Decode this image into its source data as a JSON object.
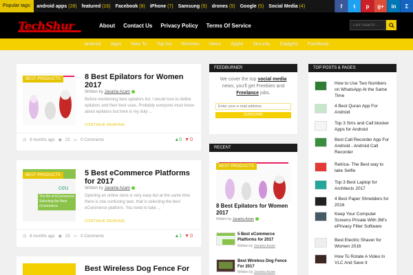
{
  "topbar": {
    "label": "Popular tags:",
    "tags": [
      {
        "name": "android apps",
        "count": "(28)"
      },
      {
        "name": "featured",
        "count": "(16)"
      },
      {
        "name": "Facebook",
        "count": "(8)"
      },
      {
        "name": "iPhone",
        "count": "(7)"
      },
      {
        "name": "Samsung",
        "count": "(5)"
      },
      {
        "name": "drones",
        "count": "(5)"
      },
      {
        "name": "Google",
        "count": "(5)"
      },
      {
        "name": "Social Media",
        "count": "(4)"
      }
    ],
    "social": [
      {
        "glyph": "f",
        "color": "#3b5998",
        "icon": "facebook-icon"
      },
      {
        "glyph": "t",
        "color": "#1da1f2",
        "icon": "twitter-icon"
      },
      {
        "glyph": "p",
        "color": "#cb2027",
        "icon": "pinterest-icon"
      },
      {
        "glyph": "g+",
        "color": "#dd4b39",
        "icon": "google-plus-icon"
      },
      {
        "glyph": "in",
        "color": "#0077b5",
        "icon": "linkedin-icon"
      },
      {
        "glyph": "Σ",
        "color": "#1565c0",
        "icon": "rss-icon"
      }
    ]
  },
  "header": {
    "logo_text": "TechShur",
    "nav": [
      "About",
      "Contact Us",
      "Privacy Policy",
      "Terms Of Service"
    ],
    "search_placeholder": "Live Search ..."
  },
  "subnav": [
    "Android",
    "Apps",
    "How To",
    "Top list",
    "Reviews",
    "News",
    "Apple",
    "Security",
    "Gadgets",
    "Facebook"
  ],
  "posts": [
    {
      "badge": "BEST PRODUCTS",
      "title": "8 Best Epilators for Women 2017",
      "author_prefix": "Written by",
      "author": "Javairia Azam",
      "excerpt": "Before mentioning best epilators list, I would love to define epilators and their best uses. Probably everyone must know about epilators but here is my duty ...",
      "more": "CONTINUE READING",
      "date": "8 months ago",
      "views": "22",
      "comments": "0 Comments",
      "up": "0",
      "down": "0"
    },
    {
      "badge": "BEST PRODUCTS",
      "title": "5 Best eCommerce Platforms for 2017",
      "author_prefix": "Written by",
      "author": "Javairia Azam",
      "excerpt": "Opening an online store is very easy but at the same time there is one confusing task, that is selecting the best eCommerce platform. You need to take ...",
      "more": "CONTINUE READING",
      "date": "8 months ago",
      "views": "23",
      "comments": "0 Comments",
      "up": "1",
      "down": "0",
      "thumb_caption_1": "The Art of ECommerce",
      "thumb_caption_2": "Selecting the Best eCommerce"
    },
    {
      "title": "Best Wireless Dog Fence For"
    }
  ],
  "feedburner": {
    "heading": "FEEDBURNER",
    "text_1": "We cover the top",
    "text_link_1": "social media",
    "text_2": "news, you'll get Freebies and",
    "text_link_2": "Freelance",
    "text_3": "jobs.",
    "email_placeholder": "Enter your e-mail address",
    "button": "SUBSCRIBE"
  },
  "recent": {
    "heading": "RECENT",
    "badge": "BEST PRODUCTS",
    "big_title": "8 Best Epilators for Women 2017",
    "big_meta_prefix": "Written by",
    "big_meta_author": "Javairia Azam",
    "small": [
      {
        "title": "5 Best eCommerce Platforms for 2017",
        "prefix": "Written by",
        "author": "Javairia Azam"
      },
      {
        "title": "Best Wireless Dog Fence For 2017",
        "prefix": "Written by",
        "author": "Javairia Azam"
      }
    ]
  },
  "top_posts": {
    "heading": "TOP POSTS & PAGES",
    "items": [
      {
        "title": "How to Use Two Numbers on WhatsApp At the Same Time",
        "color": "#2e7d32"
      },
      {
        "title": "4 Best Quran App For Android",
        "color": "#c8e6c9"
      },
      {
        "title": "Top 3 Sms and Call blocker Apps for Android",
        "color": "#f5f5f5"
      },
      {
        "title": "Best Call Recorder App For Android - Android Call Recorder",
        "color": "#388e3c"
      },
      {
        "title": "Retrica- The Best way to take Selfie",
        "color": "#e53935"
      },
      {
        "title": "Top 3 Best Laptop for Architects 2017",
        "color": "#26a69a"
      },
      {
        "title": "4 Best Paper Shredders for 2016",
        "color": "#212121"
      },
      {
        "title": "Keep Your Computer Screens Private With 3M's ePrivacy Filter Software",
        "color": "#455a64"
      },
      {
        "title": "Best Electric Shaver for Women 2016",
        "color": "#eeeeee"
      },
      {
        "title": "How To Rotate A Video In VLC And Save It",
        "color": "#3e2723"
      }
    ]
  }
}
